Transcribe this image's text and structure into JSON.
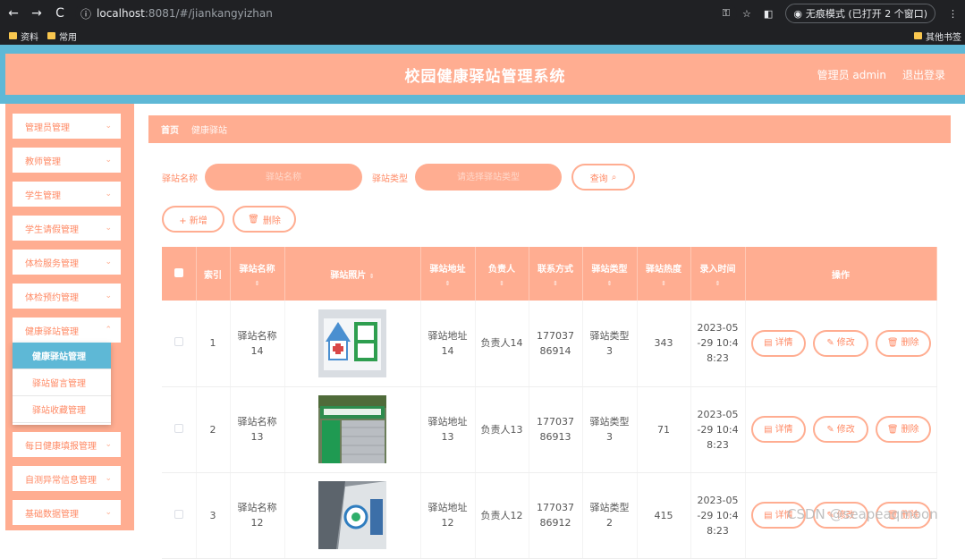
{
  "browser": {
    "url_host": "localhost",
    "url_path": ":8081/#/jiankangyizhan",
    "incognito_label": "无痕模式 (已打开 2 个窗口)",
    "bookmarks": [
      "资料",
      "常用"
    ],
    "other_bookmarks": "其他书签"
  },
  "header": {
    "title": "校园健康驿站管理系统",
    "user": "管理员 admin",
    "logout": "退出登录"
  },
  "sidebar": {
    "items": [
      {
        "label": "管理员管理"
      },
      {
        "label": "教师管理"
      },
      {
        "label": "学生管理"
      },
      {
        "label": "学生请假管理"
      },
      {
        "label": "体检服务管理"
      },
      {
        "label": "体检预约管理"
      },
      {
        "label": "健康驿站管理"
      },
      {
        "label": "每日健康填报管理"
      },
      {
        "label": "自测异常信息管理"
      },
      {
        "label": "基础数据管理"
      }
    ],
    "submenu": [
      {
        "label": "健康驿站管理"
      },
      {
        "label": "驿站留言管理"
      },
      {
        "label": "驿站收藏管理"
      }
    ]
  },
  "breadcrumb": {
    "home": "首页",
    "current": "健康驿站"
  },
  "search": {
    "name_label": "驿站名称",
    "name_placeholder": "驿站名称",
    "type_label": "驿站类型",
    "type_placeholder": "请选择驿站类型",
    "query_button": "查询"
  },
  "toolbar": {
    "add_label": "+ 新增",
    "delete_label": "删除"
  },
  "table": {
    "headers": {
      "index": "索引",
      "name": "驿站名称",
      "photo": "驿站照片",
      "address": "驿站地址",
      "owner": "负责人",
      "contact": "联系方式",
      "type": "驿站类型",
      "heat": "驿站热度",
      "time": "录入时间",
      "ops": "操作"
    },
    "rows": [
      {
        "index": "1",
        "name": "驿站名称14",
        "address": "驿站地址14",
        "owner": "负责人14",
        "contact": "17703786914",
        "type": "驿站类型3",
        "heat": "343",
        "time": "2023-05-29 10:48:23"
      },
      {
        "index": "2",
        "name": "驿站名称13",
        "address": "驿站地址13",
        "owner": "负责人13",
        "contact": "17703786913",
        "type": "驿站类型3",
        "heat": "71",
        "time": "2023-05-29 10:48:23"
      },
      {
        "index": "3",
        "name": "驿站名称12",
        "address": "驿站地址12",
        "owner": "负责人12",
        "contact": "17703786912",
        "type": "驿站类型2",
        "heat": "415",
        "time": "2023-05-29 10:48:23"
      }
    ],
    "actions": {
      "detail": "详情",
      "edit": "修改",
      "delete": "删除"
    }
  },
  "colors": {
    "accent": "#ffad91",
    "accent_text": "#ff8a65",
    "topbar": "#5eb8d6"
  },
  "watermark": "CSDN @seapeaqmoon"
}
